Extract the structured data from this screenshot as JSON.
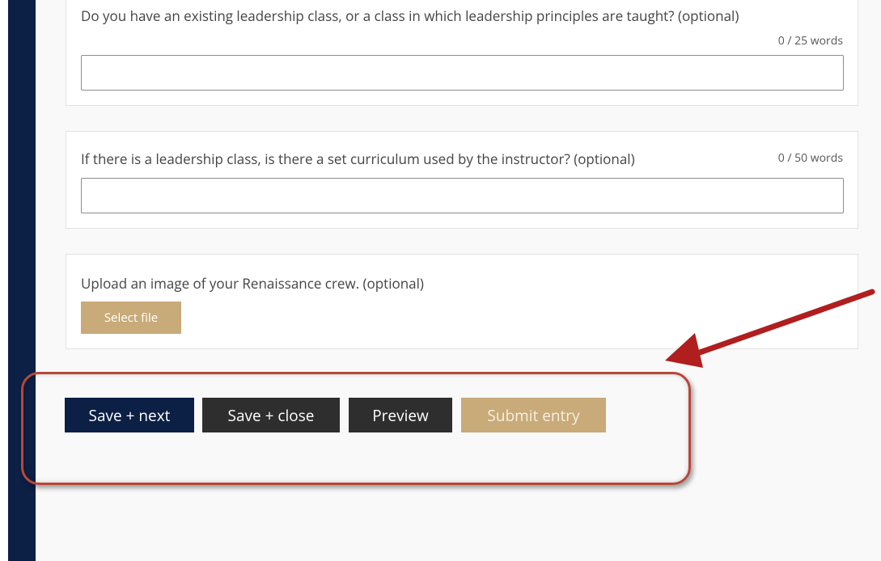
{
  "questions": [
    {
      "label": "Do you have an existing leadership class, or a class in which leadership principles are taught? (optional)",
      "word_count": "0 / 25 words",
      "value": ""
    },
    {
      "label": "If there is a leadership class, is there a set curriculum used by the instructor? (optional)",
      "word_count": "0 / 50 words",
      "value": ""
    }
  ],
  "upload": {
    "label": "Upload an image of your Renaissance crew. (optional)",
    "button_label": "Select file"
  },
  "actions": {
    "save_next": "Save + next",
    "save_close": "Save + close",
    "preview": "Preview",
    "submit": "Submit entry"
  },
  "colors": {
    "navy": "#0c1f44",
    "dark_button": "#2e2e2e",
    "gold": "#c8ab79",
    "annotation_red": "#b84738",
    "arrow_red": "#b01e1e"
  },
  "annotation": {
    "icon": "red-arrow-icon"
  }
}
